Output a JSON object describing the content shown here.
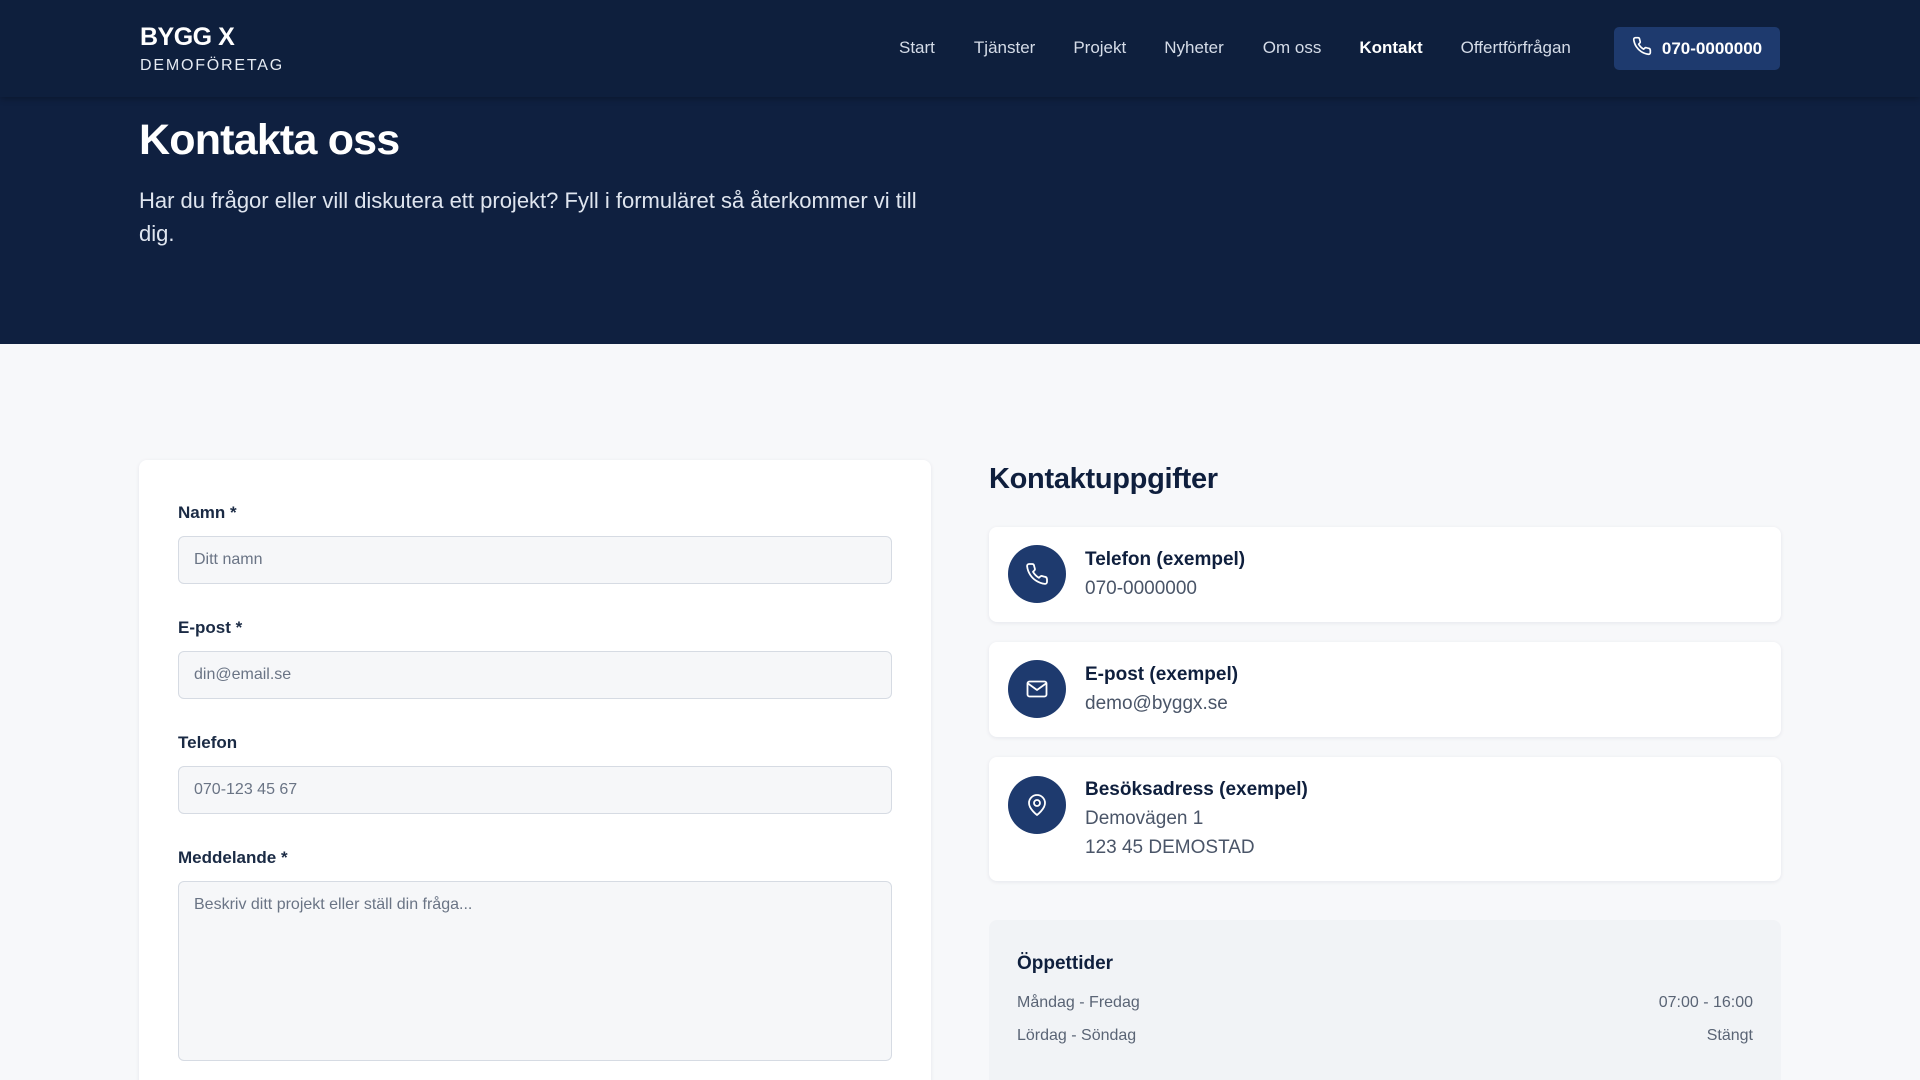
{
  "brand": {
    "name": "BYGG X",
    "subtitle": "DEMOFÖRETAG"
  },
  "nav": {
    "items": [
      {
        "label": "Start"
      },
      {
        "label": "Tjänster"
      },
      {
        "label": "Projekt"
      },
      {
        "label": "Nyheter"
      },
      {
        "label": "Om oss"
      },
      {
        "label": "Kontakt",
        "active": true
      },
      {
        "label": "Offertförfrågan"
      }
    ],
    "phone_button": "070-0000000"
  },
  "hero": {
    "title": "Kontakta oss",
    "description": "Har du frågor eller vill diskutera ett projekt? Fyll i formuläret så återkommer vi till dig."
  },
  "form": {
    "name": {
      "label": "Namn *",
      "placeholder": "Ditt namn"
    },
    "email": {
      "label": "E-post *",
      "placeholder": "din@email.se"
    },
    "phone": {
      "label": "Telefon",
      "placeholder": "070-123 45 67"
    },
    "message": {
      "label": "Meddelande *",
      "placeholder": "Beskriv ditt projekt eller ställ din fråga..."
    }
  },
  "contact_info": {
    "title": "Kontaktuppgifter",
    "phone": {
      "heading": "Telefon (exempel)",
      "value": "070-0000000",
      "icon": "phone-icon"
    },
    "email": {
      "heading": "E-post (exempel)",
      "value": "demo@byggx.se",
      "icon": "mail-icon"
    },
    "address": {
      "heading": "Besöksadress (exempel)",
      "street": "Demovägen 1",
      "city": "123 45 DEMOSTAD",
      "icon": "map-pin-icon"
    }
  },
  "hours": {
    "title": "Öppettider",
    "rows": [
      {
        "days": "Måndag - Fredag",
        "time": "07:00 - 16:00"
      },
      {
        "days": "Lördag - Söndag",
        "time": "Stängt"
      }
    ]
  },
  "colors": {
    "navy": "#0f2040",
    "accent": "#1e3a6e",
    "background": "#f7f8fa"
  }
}
